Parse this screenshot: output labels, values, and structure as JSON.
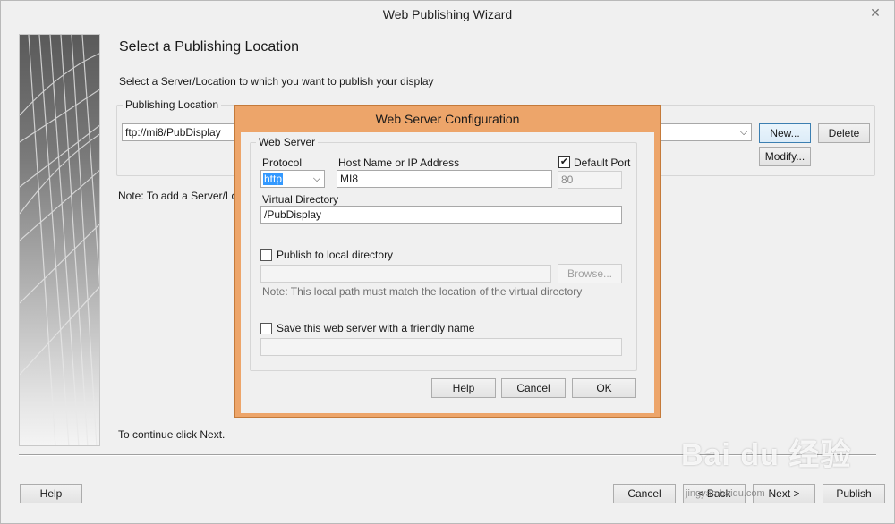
{
  "window": {
    "title": "Web Publishing Wizard",
    "close_glyph": "✕"
  },
  "wizard": {
    "heading": "Select a Publishing Location",
    "intro": "Select a Server/Location to which you want to publish your display",
    "publishing_location": {
      "legend": "Publishing Location",
      "selected_value": "ftp://mi8/PubDisplay",
      "new_label": "New...",
      "delete_label": "Delete",
      "modify_label": "Modify..."
    },
    "note": "Note: To add a Server/Loca",
    "continue_text": "To continue click Next.",
    "footer": {
      "help_label": "Help",
      "cancel_label": "Cancel",
      "back_label": "< Back",
      "next_label": "Next >",
      "publish_label": "Publish"
    }
  },
  "dialog": {
    "title": "Web Server Configuration",
    "group_legend": "Web Server",
    "protocol_label": "Protocol",
    "protocol_value": "http",
    "host_label": "Host Name or IP Address",
    "host_value": "MI8",
    "default_port_label": "Default Port",
    "default_port_checked": true,
    "port_value": "80",
    "virtual_dir_label": "Virtual Directory",
    "virtual_dir_value": "/PubDisplay",
    "publish_local_label": "Publish to local directory",
    "publish_local_checked": false,
    "local_path_value": "",
    "browse_label": "Browse...",
    "local_note": "Note: This local path must match the location of the virtual directory",
    "friendly_name_label": "Save this web server with a friendly name",
    "friendly_name_checked": false,
    "friendly_name_value": "",
    "help_label": "Help",
    "cancel_label": "Cancel",
    "ok_label": "OK"
  },
  "watermark": {
    "brand": "Bai du 经验",
    "sub": "jingyan.baidu.com"
  },
  "colors": {
    "dialog_frame": "#eda56a",
    "selection": "#3399ff",
    "default_button_border": "#3c7fb1"
  }
}
